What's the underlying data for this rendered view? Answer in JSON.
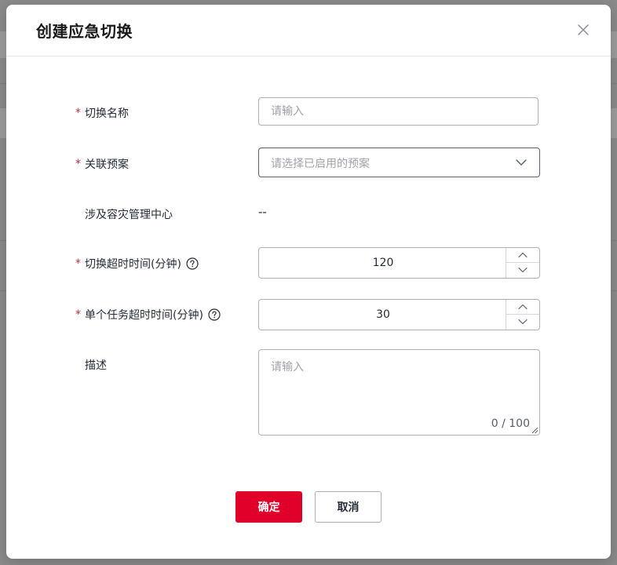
{
  "dialog": {
    "title": "创建应急切换",
    "close_icon": "close-icon"
  },
  "form": {
    "switch_name": {
      "label": "切换名称",
      "required": "*",
      "placeholder": "请输入"
    },
    "related_plan": {
      "label": "关联预案",
      "required": "*",
      "placeholder": "请选择已启用的预案"
    },
    "dr_center": {
      "label": "涉及容灾管理中心",
      "value": "--"
    },
    "switch_timeout": {
      "label": "切换超时时间(分钟)",
      "required": "*",
      "value": "120"
    },
    "task_timeout": {
      "label": "单个任务超时时间(分钟)",
      "required": "*",
      "value": "30"
    },
    "description": {
      "label": "描述",
      "placeholder": "请输入",
      "char_count": "0 / 100"
    }
  },
  "buttons": {
    "confirm": "确定",
    "cancel": "取消"
  },
  "colors": {
    "primary": "#e0002a",
    "required": "#e0263c"
  }
}
